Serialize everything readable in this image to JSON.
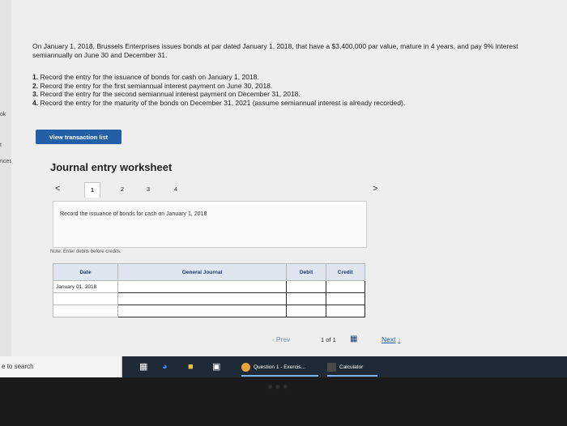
{
  "left_strip": {
    "items": [
      "ok",
      "",
      "t",
      "nces"
    ]
  },
  "intro": "On January 1, 2018, Brussels Enterprises issues bonds at par dated January 1, 2018, that have a $3,400,000 par value, mature in 4 years, and pay 9% interest semiannually on June 30 and December 31.",
  "tasks": [
    {
      "num": "1.",
      "text": "Record the entry for the issuance of bonds for cash on January 1, 2018."
    },
    {
      "num": "2.",
      "text": "Record the entry for the first semiannual interest payment on June 30, 2018."
    },
    {
      "num": "3.",
      "text": "Record the entry for the second semiannual interest payment on December 31, 2018."
    },
    {
      "num": "4.",
      "text": "Record the entry for the maturity of the bonds on December 31, 2021 (assume semiannual interest is already recorded)."
    }
  ],
  "view_button": "View transaction list",
  "worksheet": {
    "title": "Journal entry worksheet",
    "prev_arrow": "<",
    "next_arrow": ">",
    "tabs": [
      "1",
      "2",
      "3",
      "4"
    ],
    "instruction": "Record the issuance of bonds for cash on January 1, 2018",
    "note": "Note: Enter debits before credits.",
    "columns": [
      "Date",
      "General Journal",
      "Debit",
      "Credit"
    ],
    "first_date": "January 01, 2018"
  },
  "pager": {
    "prev": "Prev",
    "page_of": "1 of 1",
    "next": "Next"
  },
  "taskbar": {
    "search": "e to search",
    "chip1": "Question 1 - Exercis...",
    "chip2": "Calculator"
  },
  "colors": {
    "accent": "#2360a8",
    "header_bg": "#dfe6ef",
    "taskbar": "#1e2a36"
  }
}
